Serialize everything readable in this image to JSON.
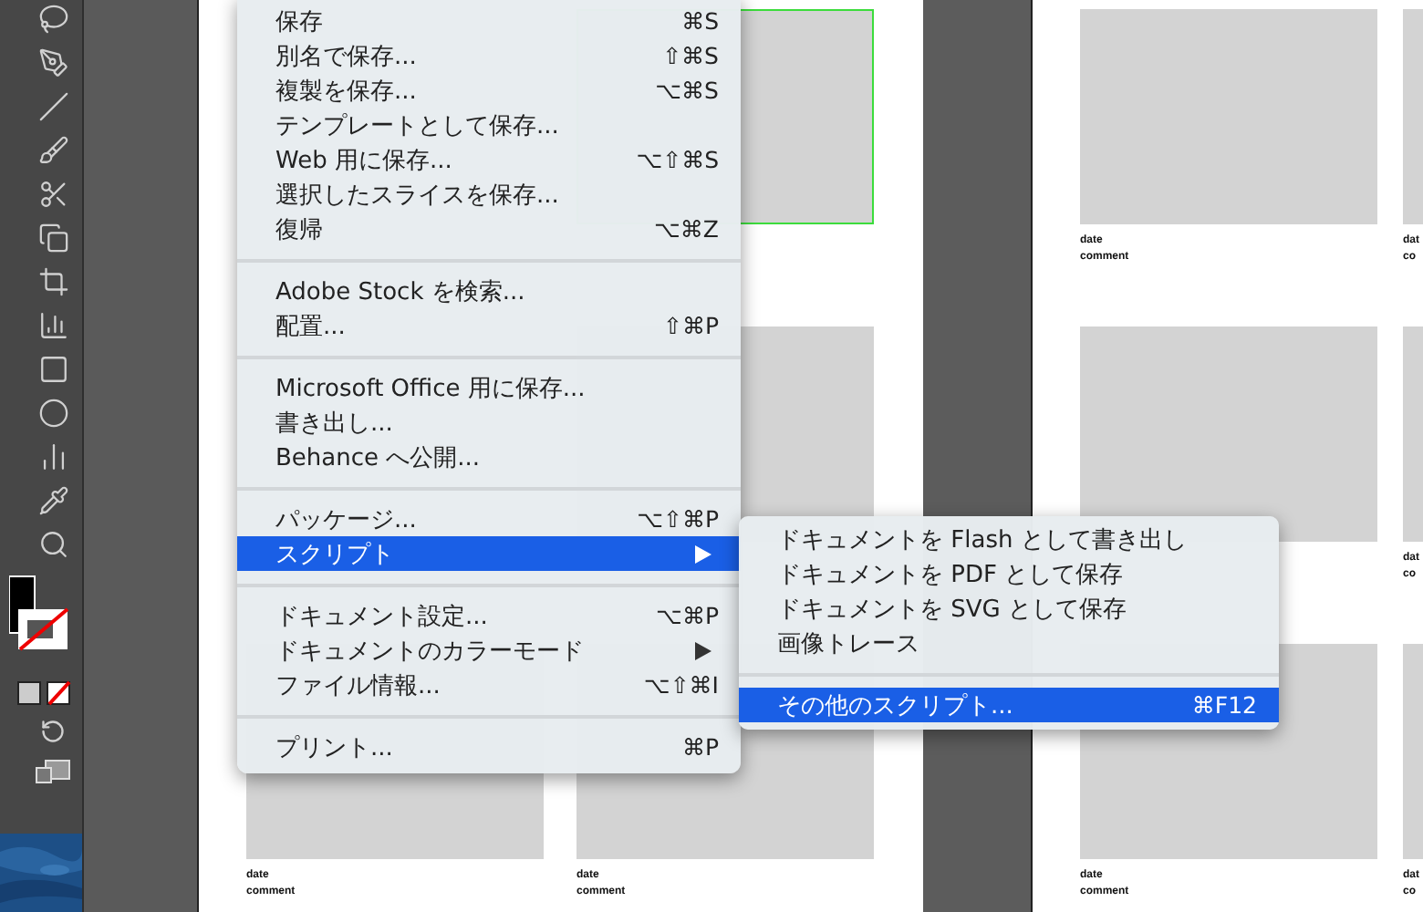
{
  "menu": {
    "groups": [
      [
        {
          "label": "保存",
          "shortcut": "⌘S",
          "submenu": false,
          "selected": false
        },
        {
          "label": "別名で保存...",
          "shortcut": "⇧⌘S",
          "submenu": false,
          "selected": false
        },
        {
          "label": "複製を保存...",
          "shortcut": "⌥⌘S",
          "submenu": false,
          "selected": false
        },
        {
          "label": "テンプレートとして保存...",
          "submenu": false,
          "selected": false
        },
        {
          "label": "Web 用に保存...",
          "shortcut": "⌥⇧⌘S",
          "submenu": false,
          "selected": false
        },
        {
          "label": "選択したスライスを保存...",
          "submenu": false,
          "selected": false
        },
        {
          "label": "復帰",
          "shortcut": "⌥⌘Z",
          "submenu": false,
          "selected": false
        }
      ],
      [
        {
          "label": "Adobe Stock を検索...",
          "submenu": false,
          "selected": false
        },
        {
          "label": "配置...",
          "shortcut": "⇧⌘P",
          "submenu": false,
          "selected": false
        }
      ],
      [
        {
          "label": "Microsoft Office 用に保存...",
          "submenu": false,
          "selected": false
        },
        {
          "label": "書き出し...",
          "submenu": false,
          "selected": false
        },
        {
          "label": "Behance へ公開...",
          "submenu": false,
          "selected": false
        }
      ],
      [
        {
          "label": "パッケージ...",
          "shortcut": "⌥⇧⌘P",
          "submenu": false,
          "selected": false
        },
        {
          "label": "スクリプト",
          "submenu": true,
          "selected": true
        }
      ],
      [
        {
          "label": "ドキュメント設定...",
          "shortcut": "⌥⌘P",
          "submenu": false,
          "selected": false
        },
        {
          "label": "ドキュメントのカラーモード",
          "submenu": true,
          "selected": false
        },
        {
          "label": "ファイル情報...",
          "shortcut": "⌥⇧⌘I",
          "submenu": false,
          "selected": false
        }
      ],
      [
        {
          "label": "プリント...",
          "shortcut": "⌘P",
          "submenu": false,
          "selected": false
        }
      ]
    ]
  },
  "submenu": {
    "groups": [
      [
        {
          "label": "ドキュメントを Flash として書き出し",
          "selected": false
        },
        {
          "label": "ドキュメントを PDF として保存",
          "selected": false
        },
        {
          "label": "ドキュメントを SVG として保存",
          "selected": false
        },
        {
          "label": "画像トレース",
          "selected": false
        }
      ],
      [
        {
          "label": "その他のスクリプト...",
          "shortcut": "⌘F12",
          "selected": true
        }
      ]
    ]
  },
  "artboards": [
    {
      "cards": [
        {
          "kind": "covered"
        },
        {
          "kind": "card",
          "selected": true
        },
        {
          "kind": "covered"
        },
        {
          "kind": "card",
          "selected": false
        },
        {
          "kind": "card",
          "selected": false,
          "date": "date",
          "comment": "comment"
        },
        {
          "kind": "card",
          "selected": false,
          "date": "date",
          "comment": "comment"
        }
      ]
    },
    {
      "cards": [
        {
          "kind": "card",
          "selected": false,
          "date": "date",
          "comment": "comment"
        },
        {
          "kind": "card",
          "selected": false,
          "date": "dat",
          "comment": "co"
        },
        {
          "kind": "card",
          "selected": false
        },
        {
          "kind": "card",
          "selected": false,
          "date": "dat",
          "comment": "co"
        },
        {
          "kind": "card",
          "selected": false,
          "date": "date",
          "comment": "comment"
        },
        {
          "kind": "card",
          "selected": false,
          "date": "dat",
          "comment": "co"
        }
      ]
    }
  ]
}
